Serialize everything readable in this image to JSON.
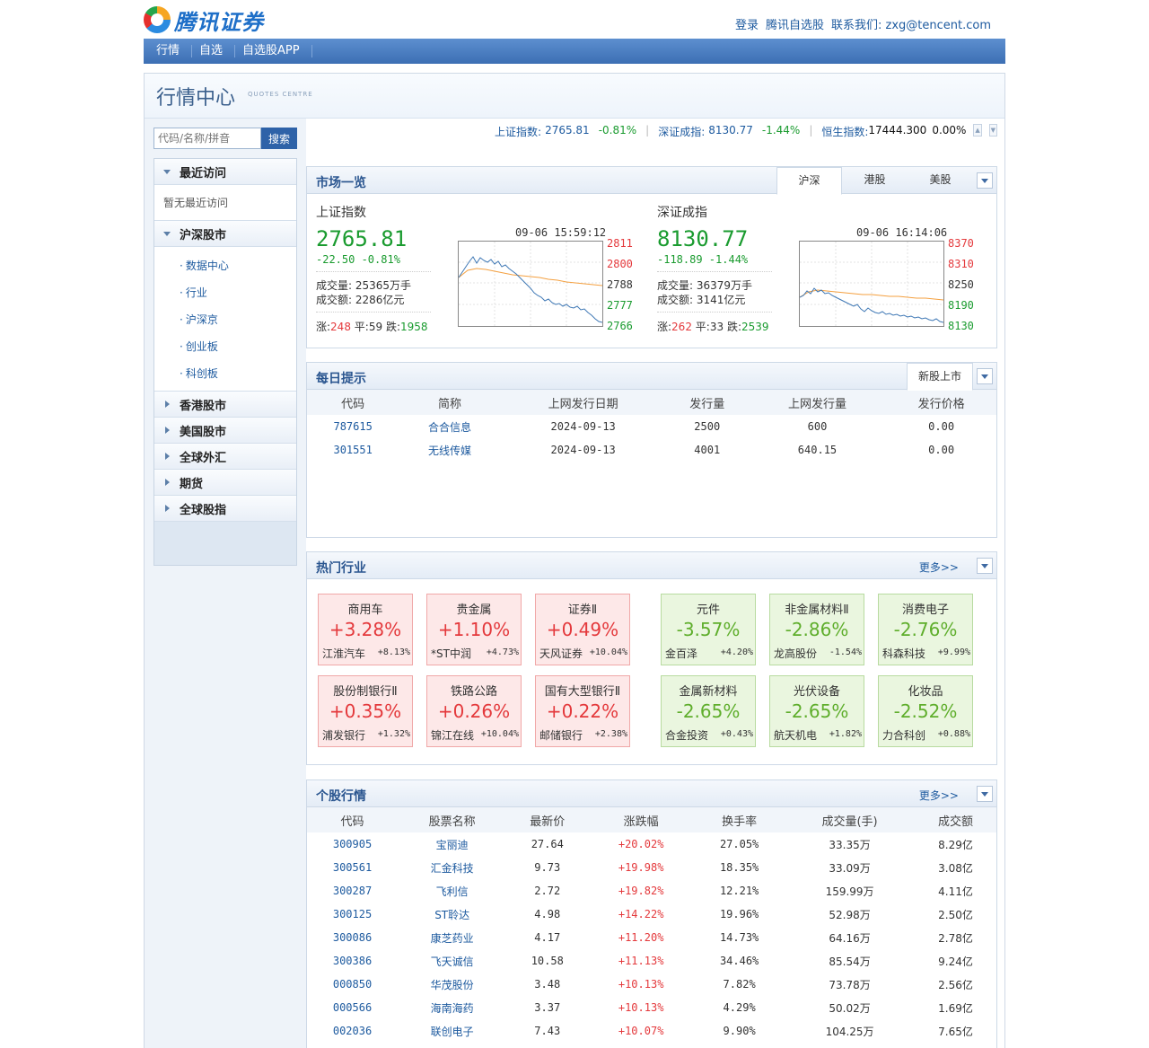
{
  "header": {
    "logo_text": "腾讯证券",
    "links": [
      "登录",
      "腾讯自选股",
      "联系我们: zxg@tencent.com"
    ]
  },
  "nav": [
    "行情",
    "自选",
    "自选股APP"
  ],
  "page": {
    "title": "行情中心",
    "subtitle": "QUOTES CENTRE"
  },
  "search": {
    "placeholder": "代码/名称/拼音",
    "button": "搜索"
  },
  "sidebar": {
    "recent": {
      "title": "最近访问",
      "empty": "暂无最近访问"
    },
    "hs": {
      "title": "沪深股市",
      "items": [
        "数据中心",
        "行业",
        "沪深京",
        "创业板",
        "科创板"
      ]
    },
    "collapsed": [
      "香港股市",
      "美国股市",
      "全球外汇",
      "期货",
      "全球股指"
    ]
  },
  "ticker": {
    "sh": {
      "name": "上证指数:",
      "value": "2765.81",
      "change": "-0.81%"
    },
    "sz": {
      "name": "深证成指:",
      "value": "8130.77",
      "change": "-1.44%"
    },
    "hsi": {
      "name": "恒生指数:",
      "value": "17444.300",
      "change": "0.00%"
    }
  },
  "market": {
    "title": "市场一览",
    "tabs": [
      "沪深",
      "港股",
      "美股"
    ],
    "sh": {
      "name": "上证指数",
      "price": "2765.81",
      "change": "-22.50 -0.81%",
      "time": "09-06 15:59:12",
      "volume": "成交量: 25365万手",
      "amount": "成交额: 2286亿元",
      "up_label": "涨:",
      "up": "248",
      "flat_label": "平:",
      "flat": "59",
      "down_label": "跌:",
      "down": "1958",
      "yticks": [
        "2811",
        "2800",
        "2788",
        "2777",
        "2766"
      ]
    },
    "sz": {
      "name": "深证成指",
      "price": "8130.77",
      "change": "-118.89 -1.44%",
      "time": "09-06 16:14:06",
      "volume": "成交量: 36379万手",
      "amount": "成交额: 3141亿元",
      "up_label": "涨:",
      "up": "262",
      "flat_label": "平:",
      "flat": "33",
      "down_label": "跌:",
      "down": "2539",
      "yticks": [
        "8370",
        "8310",
        "8250",
        "8190",
        "8130"
      ]
    }
  },
  "daily": {
    "title": "每日提示",
    "tab": "新股上市",
    "columns": [
      "代码",
      "简称",
      "上网发行日期",
      "发行量",
      "上网发行量",
      "发行价格"
    ],
    "rows": [
      [
        "787615",
        "合合信息",
        "2024-09-13",
        "2500",
        "600",
        "0.00"
      ],
      [
        "301551",
        "无线传媒",
        "2024-09-13",
        "4001",
        "640.15",
        "0.00"
      ]
    ]
  },
  "hot": {
    "title": "热门行业",
    "more": "更多>>",
    "cards": [
      {
        "name": "商用车",
        "pct": "+3.28%",
        "stock": "江淮汽车",
        "spct": "+8.13%",
        "dir": "up"
      },
      {
        "name": "贵金属",
        "pct": "+1.10%",
        "stock": "*ST中润",
        "spct": "+4.73%",
        "dir": "up"
      },
      {
        "name": "证券Ⅱ",
        "pct": "+0.49%",
        "stock": "天风证券",
        "spct": "+10.04%",
        "dir": "up"
      },
      {
        "name": "元件",
        "pct": "-3.57%",
        "stock": "金百泽",
        "spct": "+4.20%",
        "dir": "dn"
      },
      {
        "name": "非金属材料Ⅱ",
        "pct": "-2.86%",
        "stock": "龙高股份",
        "spct": "-1.54%",
        "dir": "dn"
      },
      {
        "name": "消费电子",
        "pct": "-2.76%",
        "stock": "科森科技",
        "spct": "+9.99%",
        "dir": "dn"
      },
      {
        "name": "股份制银行Ⅱ",
        "pct": "+0.35%",
        "stock": "浦发银行",
        "spct": "+1.32%",
        "dir": "up"
      },
      {
        "name": "铁路公路",
        "pct": "+0.26%",
        "stock": "锦江在线",
        "spct": "+10.04%",
        "dir": "up"
      },
      {
        "name": "国有大型银行Ⅱ",
        "pct": "+0.22%",
        "stock": "邮储银行",
        "spct": "+2.38%",
        "dir": "up"
      },
      {
        "name": "金属新材料",
        "pct": "-2.65%",
        "stock": "合金投资",
        "spct": "+0.43%",
        "dir": "dn"
      },
      {
        "name": "光伏设备",
        "pct": "-2.65%",
        "stock": "航天机电",
        "spct": "+1.82%",
        "dir": "dn"
      },
      {
        "name": "化妆品",
        "pct": "-2.52%",
        "stock": "力合科创",
        "spct": "+0.88%",
        "dir": "dn"
      }
    ]
  },
  "stocks": {
    "title": "个股行情",
    "more": "更多>>",
    "columns": [
      "代码",
      "股票名称",
      "最新价",
      "涨跌幅",
      "换手率",
      "成交量(手)",
      "成交额"
    ],
    "rows": [
      [
        "300905",
        "宝丽迪",
        "27.64",
        "+20.02%",
        "27.05%",
        "33.35万",
        "8.29亿"
      ],
      [
        "300561",
        "汇金科技",
        "9.73",
        "+19.98%",
        "18.35%",
        "33.09万",
        "3.08亿"
      ],
      [
        "300287",
        "飞利信",
        "2.72",
        "+19.82%",
        "12.21%",
        "159.99万",
        "4.11亿"
      ],
      [
        "300125",
        "ST聆达",
        "4.98",
        "+14.22%",
        "19.96%",
        "52.98万",
        "2.50亿"
      ],
      [
        "300086",
        "康芝药业",
        "4.17",
        "+11.20%",
        "14.73%",
        "64.16万",
        "2.78亿"
      ],
      [
        "300386",
        "飞天诚信",
        "10.58",
        "+11.13%",
        "34.46%",
        "85.54万",
        "9.24亿"
      ],
      [
        "000850",
        "华茂股份",
        "3.48",
        "+10.13%",
        "7.82%",
        "73.78万",
        "2.56亿"
      ],
      [
        "000566",
        "海南海药",
        "3.37",
        "+10.13%",
        "4.29%",
        "50.02万",
        "1.69亿"
      ],
      [
        "002036",
        "联创电子",
        "7.43",
        "+10.07%",
        "9.90%",
        "104.25万",
        "7.65亿"
      ]
    ]
  },
  "colors": {
    "nav": "#3c6fb4",
    "up": "#e4393c",
    "down": "#1a9b2f"
  }
}
